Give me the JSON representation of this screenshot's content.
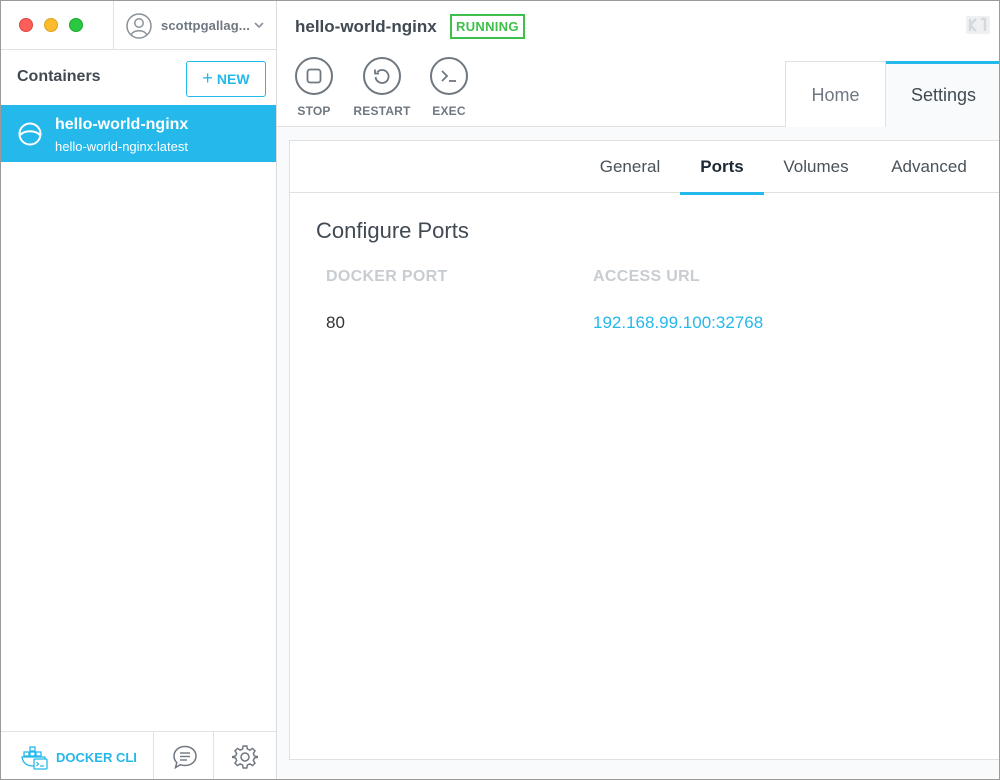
{
  "sidebar": {
    "user": {
      "name": "scottpgallag..."
    },
    "containers_label": "Containers",
    "new_button": "NEW",
    "containers": [
      {
        "name": "hello-world-nginx",
        "image": "hello-world-nginx:latest",
        "selected": true
      }
    ],
    "footer": {
      "docker_cli_label": "DOCKER CLI"
    }
  },
  "header": {
    "container_name": "hello-world-nginx",
    "status": "RUNNING",
    "actions": {
      "stop": "STOP",
      "restart": "RESTART",
      "exec": "EXEC"
    },
    "tabs": {
      "home": "Home",
      "settings": "Settings"
    },
    "active_tab": "Settings"
  },
  "settings": {
    "subtabs": {
      "general": "General",
      "ports": "Ports",
      "volumes": "Volumes",
      "advanced": "Advanced"
    },
    "active_subtab": "Ports",
    "section_title": "Configure Ports",
    "columns": {
      "docker_port": "DOCKER PORT",
      "access_url": "ACCESS URL"
    },
    "ports": [
      {
        "docker_port": "80",
        "access_url": "192.168.99.100:32768"
      }
    ]
  },
  "colors": {
    "accent": "#24b8eb",
    "running": "#3fc04a",
    "close": "#fc5f57",
    "minimize": "#fdbc2e",
    "zoom": "#29c840"
  },
  "icons": [
    "user-avatar-icon",
    "chevron-down-icon",
    "plus-icon",
    "container-icon",
    "docker-whale-icon",
    "chat-bubble-icon",
    "gear-icon",
    "stop-icon",
    "restart-icon",
    "terminal-icon",
    "kitematic-logo"
  ]
}
